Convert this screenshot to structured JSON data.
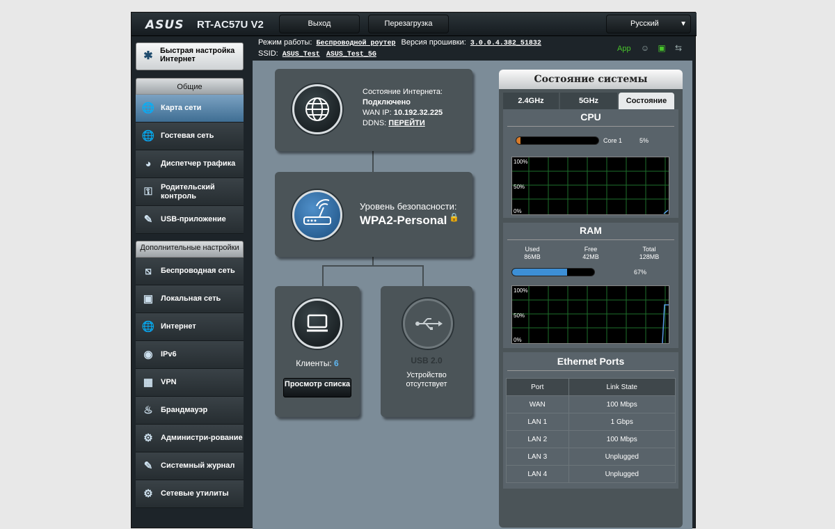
{
  "header": {
    "logo": "ASUS",
    "model": "RT-AC57U V2",
    "logout_label": "Выход",
    "reboot_label": "Перезагрузка",
    "language": "Русский"
  },
  "infobar": {
    "mode_label": "Режим работы:",
    "mode_value": "Беспроводной роутер",
    "firmware_label": "Версия прошивки:",
    "firmware_value": "3.0.0.4.382_51832",
    "ssid_label": "SSID:",
    "ssid_1": "ASUS_Test",
    "ssid_2": "ASUS_Test_5G",
    "app_label": "App"
  },
  "sidebar": {
    "quick_setup": "Быстрая настройка Интернет",
    "general_header": "Общие",
    "general_items": [
      {
        "label": "Карта сети",
        "icon": "globe-icon"
      },
      {
        "label": "Гостевая сеть",
        "icon": "guest-globe-icon"
      },
      {
        "label": "Диспетчер трафика",
        "icon": "speedometer-icon"
      },
      {
        "label": "Родительский контроль",
        "icon": "lock-shield-icon"
      },
      {
        "label": "USB-приложение",
        "icon": "usb-stick-icon"
      }
    ],
    "advanced_header": "Дополнительные настройки",
    "advanced_items": [
      {
        "label": "Беспроводная сеть",
        "icon": "wifi-icon"
      },
      {
        "label": "Локальная сеть",
        "icon": "lan-icon"
      },
      {
        "label": "Интернет",
        "icon": "internet-globe-icon"
      },
      {
        "label": "IPv6",
        "icon": "ipv6-icon"
      },
      {
        "label": "VPN",
        "icon": "vpn-icon"
      },
      {
        "label": "Брандмауэр",
        "icon": "firewall-icon"
      },
      {
        "label": "Администри-рование",
        "icon": "admin-gear-icon"
      },
      {
        "label": "Системный журнал",
        "icon": "log-icon"
      },
      {
        "label": "Сетевые утилиты",
        "icon": "tools-icon"
      }
    ]
  },
  "map": {
    "internet_status_label": "Состояние Интернета:",
    "internet_status_value": "Подключено",
    "wan_ip_label": "WAN IP:",
    "wan_ip_value": "10.192.32.225",
    "ddns_label": "DDNS:",
    "ddns_link": "ПЕРЕЙТИ",
    "security_label": "Уровень безопасности:",
    "security_value": "WPA2-Personal",
    "clients_label": "Клиенты:",
    "clients_count": "6",
    "view_list_button": "Просмотр списка",
    "usb_label": "USB 2.0",
    "usb_status": "Устройство отсутствует"
  },
  "status_panel": {
    "title": "Состояние системы",
    "tabs": [
      "2.4GHz",
      "5GHz",
      "Состояние"
    ],
    "active_tab": "Состояние",
    "cpu": {
      "title": "CPU",
      "core_label": "Core 1",
      "usage_text": "5%",
      "usage_fraction": 0.05,
      "graph_labels": [
        "100%",
        "50%",
        "0%"
      ]
    },
    "ram": {
      "title": "RAM",
      "used_label": "Used",
      "used_value": "86MB",
      "free_label": "Free",
      "free_value": "42MB",
      "total_label": "Total",
      "total_value": "128MB",
      "usage_text": "67%",
      "usage_fraction": 0.67,
      "graph_labels": [
        "100%",
        "50%",
        "0%"
      ]
    },
    "ethernet": {
      "title": "Ethernet Ports",
      "headers": [
        "Port",
        "Link State"
      ],
      "rows": [
        [
          "WAN",
          "100 Mbps"
        ],
        [
          "LAN 1",
          "1 Gbps"
        ],
        [
          "LAN 2",
          "100 Mbps"
        ],
        [
          "LAN 3",
          "Unplugged"
        ],
        [
          "LAN 4",
          "Unplugged"
        ]
      ]
    }
  },
  "colors": {
    "accent_blue": "#3d8fd6",
    "app_green": "#48c52b",
    "clients_count": "#5fb6f0"
  }
}
